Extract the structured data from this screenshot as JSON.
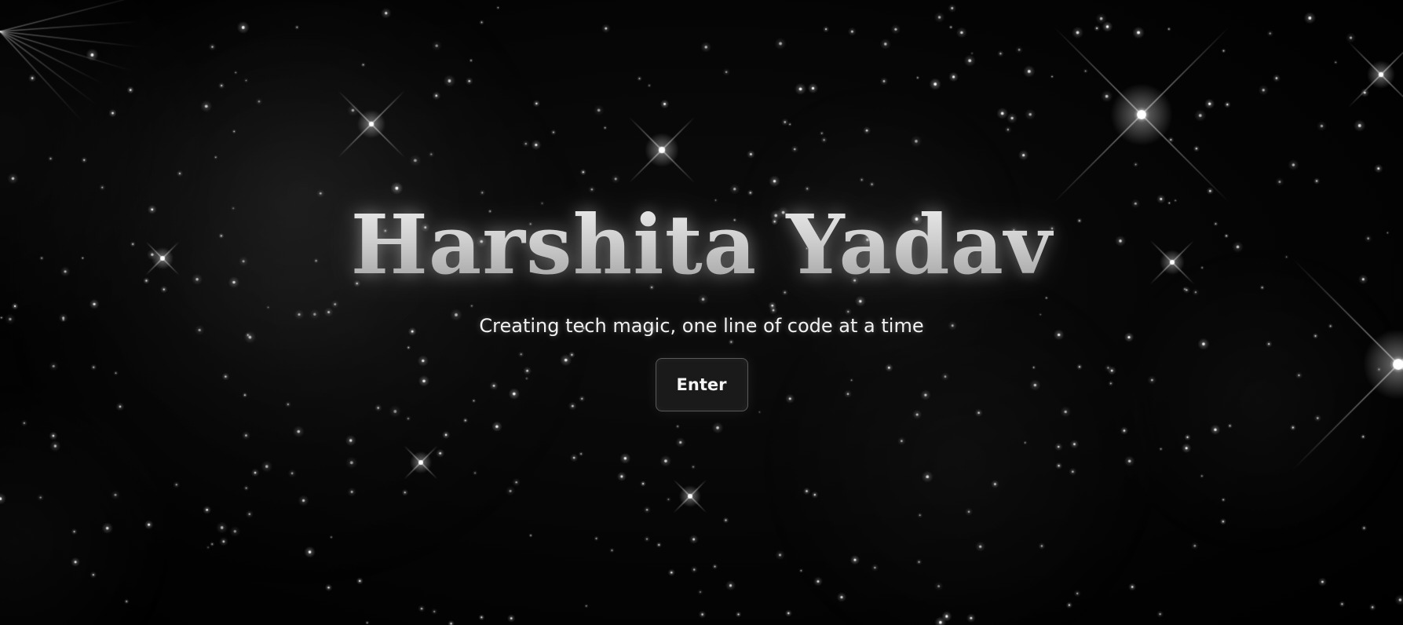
{
  "hero": {
    "title": "Harshita Yadav",
    "tagline": "Creating tech magic, one line of code at a time",
    "button_label": "Enter"
  },
  "theme": {
    "background": "#000000",
    "star_color": "#ffffff",
    "title_color": "#c7c7c7",
    "button_background": "#1a1a1a",
    "button_border": "#5a5a5a"
  },
  "background_decoration": "starfield"
}
